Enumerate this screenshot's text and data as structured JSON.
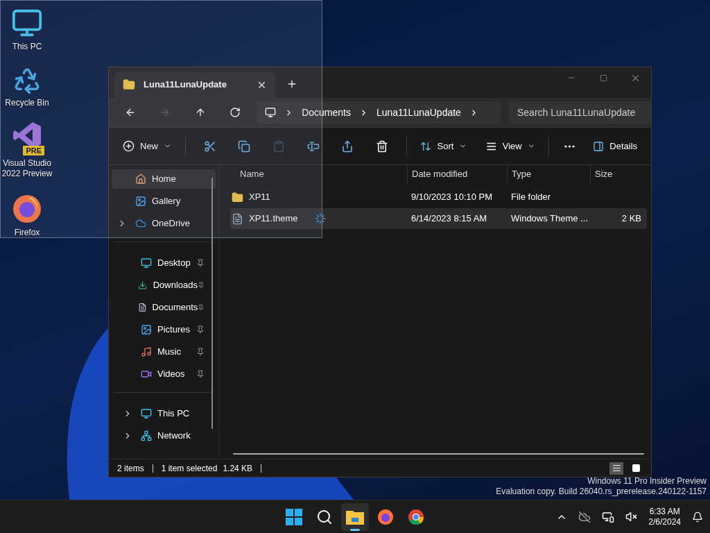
{
  "desktop_icons": [
    {
      "label": "This PC",
      "kind": "pc"
    },
    {
      "label": "Recycle Bin",
      "kind": "recycle"
    },
    {
      "label": "Visual Studio 2022 Preview",
      "kind": "vs",
      "badge": "PRE"
    },
    {
      "label": "Firefox",
      "kind": "firefox"
    }
  ],
  "window": {
    "tab": {
      "title": "Luna11LunaUpdate"
    },
    "nav": [
      {
        "kind": "back",
        "disabled": false
      },
      {
        "kind": "forward",
        "disabled": true
      },
      {
        "kind": "up",
        "disabled": false
      },
      {
        "kind": "refresh",
        "disabled": false
      }
    ],
    "breadcrumb": [
      "Documents",
      "Luna11LunaUpdate"
    ],
    "search": {
      "placeholder": "Search Luna11LunaUpdate"
    },
    "toolbar": {
      "new_label": "New",
      "actions": [
        {
          "kind": "cut",
          "disabled": false
        },
        {
          "kind": "copy",
          "disabled": false
        },
        {
          "kind": "paste",
          "disabled": true
        },
        {
          "kind": "rename",
          "disabled": false
        },
        {
          "kind": "share",
          "disabled": false
        },
        {
          "kind": "delete",
          "disabled": false
        }
      ],
      "sort_label": "Sort",
      "view_label": "View",
      "details_label": "Details"
    },
    "sidebar": {
      "sections": [
        [
          {
            "label": "Home",
            "kind": "home",
            "selected": true,
            "expandable": false,
            "pinned": false
          },
          {
            "label": "Gallery",
            "kind": "gallery",
            "selected": false,
            "expandable": false,
            "pinned": false
          },
          {
            "label": "OneDrive",
            "kind": "cloud",
            "selected": false,
            "expandable": true,
            "pinned": false
          }
        ],
        [
          {
            "label": "Desktop",
            "kind": "desktop",
            "selected": false,
            "expandable": false,
            "pinned": true
          },
          {
            "label": "Downloads",
            "kind": "downloads",
            "selected": false,
            "expandable": false,
            "pinned": true
          },
          {
            "label": "Documents",
            "kind": "documents",
            "selected": false,
            "expandable": false,
            "pinned": true
          },
          {
            "label": "Pictures",
            "kind": "pictures",
            "selected": false,
            "expandable": false,
            "pinned": true
          },
          {
            "label": "Music",
            "kind": "music",
            "selected": false,
            "expandable": false,
            "pinned": true
          },
          {
            "label": "Videos",
            "kind": "videos",
            "selected": false,
            "expandable": false,
            "pinned": true
          }
        ],
        [
          {
            "label": "This PC",
            "kind": "pc",
            "selected": false,
            "expandable": true,
            "pinned": false
          },
          {
            "label": "Network",
            "kind": "network",
            "selected": false,
            "expandable": true,
            "pinned": false
          }
        ]
      ]
    },
    "table": {
      "columns": [
        "Name",
        "Date modified",
        "Type",
        "Size"
      ],
      "rows": [
        {
          "kind": "folder",
          "name": "XP11",
          "date": "9/10/2023 10:10 PM",
          "type": "File folder",
          "size": "",
          "selected": false,
          "syncing": false
        },
        {
          "kind": "theme",
          "name": "XP11.theme",
          "date": "6/14/2023 8:15 AM",
          "type": "Windows Theme ...",
          "size": "2 KB",
          "selected": true,
          "syncing": true
        }
      ]
    },
    "status_bar": {
      "count": "2 items",
      "selection": "1 item selected",
      "size": "1.24 KB"
    }
  },
  "watermark": [
    "Windows 11 Pro Insider Preview",
    "Evaluation copy. Build 26040.rs_prerelease.240122-1157"
  ],
  "taskbar": {
    "apps": [
      {
        "kind": "start",
        "selected": false
      },
      {
        "kind": "search",
        "selected": false
      },
      {
        "kind": "explorer",
        "selected": true
      },
      {
        "kind": "firefox",
        "selected": false
      },
      {
        "kind": "chrome",
        "selected": false
      }
    ],
    "time": "6:33 AM",
    "date": "2/6/2024"
  }
}
